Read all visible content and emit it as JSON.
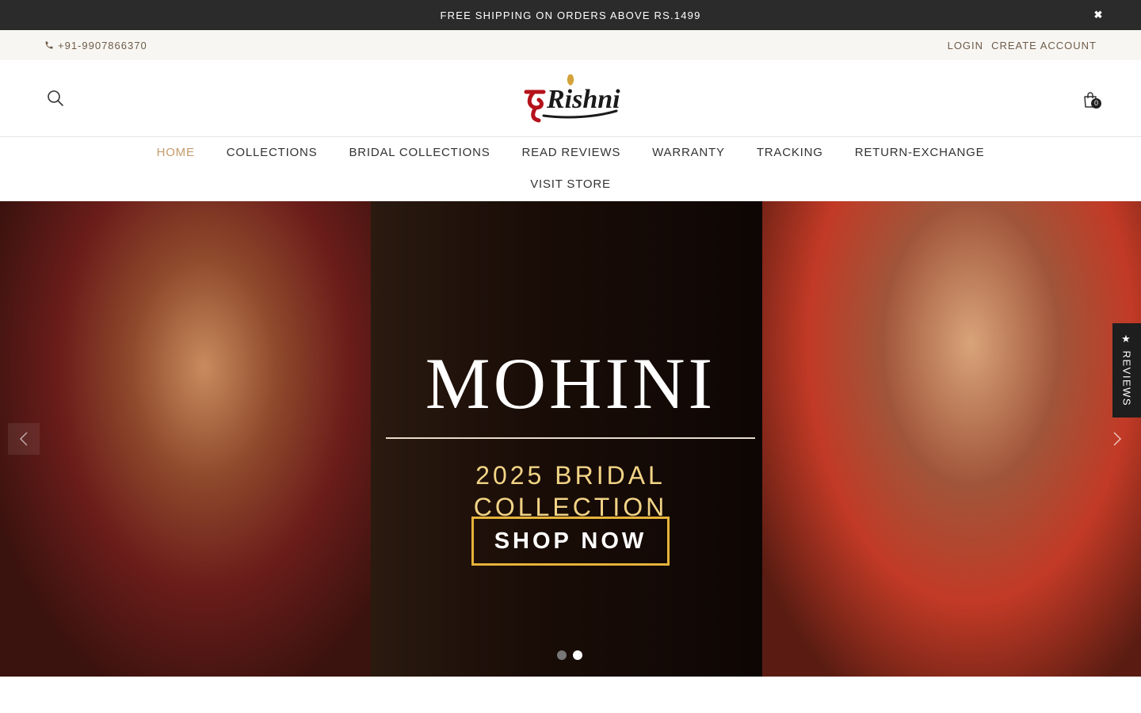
{
  "announcement": {
    "text": "FREE SHIPPING ON ORDERS ABOVE RS.1499",
    "close_icon": "✖"
  },
  "utility": {
    "phone": "+91-9907866370",
    "login": "LOGIN",
    "create_account": "CREATE ACCOUNT"
  },
  "header": {
    "logo_text": "Rishni",
    "cart_count": "0"
  },
  "nav": {
    "row1": [
      "HOME",
      "COLLECTIONS",
      "BRIDAL COLLECTIONS",
      "READ REVIEWS",
      "WARRANTY",
      "TRACKING",
      "RETURN-EXCHANGE"
    ],
    "row2": [
      "VISIT STORE"
    ],
    "active": "HOME"
  },
  "hero": {
    "title": "MOHINI",
    "subtitle": "2025 BRIDAL COLLECTION",
    "cta": "SHOP NOW",
    "slides_total": 2,
    "active_slide": 2
  },
  "reviews_tab": {
    "label": "★ REVIEWS"
  },
  "colors": {
    "accent": "#c49a6c",
    "cta_border": "#e6b23a",
    "subtitle_gold": "#f2d486",
    "announcement_bg": "#2b2b2b"
  },
  "icons": [
    "phone-icon",
    "search-icon",
    "cart-icon",
    "close-icon",
    "chevron-left-icon",
    "chevron-right-icon",
    "star-icon"
  ]
}
